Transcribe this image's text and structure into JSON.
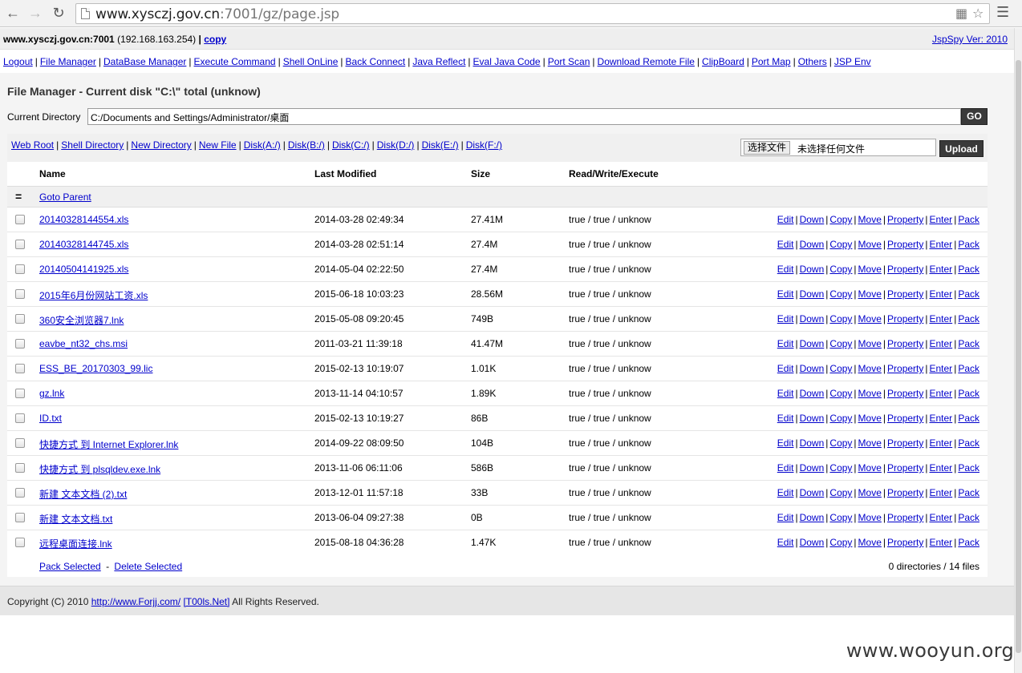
{
  "browser": {
    "url_host": "www.xysczj.gov.cn",
    "url_path": ":7001/gz/page.jsp"
  },
  "header": {
    "host": "www.xysczj.gov.cn:7001",
    "ip": "(192.168.163.254)",
    "separator": "|",
    "copy_label": "copy",
    "version_link": "JspSpy Ver: 2010"
  },
  "menu": [
    "Logout",
    "File Manager",
    "DataBase Manager",
    "Execute Command",
    "Shell OnLine",
    "Back Connect",
    "Java Reflect",
    "Eval Java Code",
    "Port Scan",
    "Download Remote File",
    "ClipBoard",
    "Port Map",
    "Others",
    "JSP Env"
  ],
  "file_manager": {
    "title": "File Manager - Current disk \"C:\\\" total (unknow)",
    "current_dir_label": "Current Directory",
    "current_dir_value": "C:/Documents and Settings/Administrator/桌面",
    "go_label": "GO",
    "shortcuts": [
      "Web Root",
      "Shell Directory",
      "New Directory",
      "New File",
      "Disk(A:/)",
      "Disk(B:/)",
      "Disk(C:/)",
      "Disk(D:/)",
      "Disk(E:/)",
      "Disk(F:/)"
    ],
    "choose_file_label": "选择文件",
    "no_file_label": "未选择任何文件",
    "upload_label": "Upload",
    "columns": {
      "name": "Name",
      "modified": "Last Modified",
      "size": "Size",
      "rwx": "Read/Write/Execute"
    },
    "parent_icon": "=",
    "goto_parent": "Goto Parent",
    "actions": [
      "Edit",
      "Down",
      "Copy",
      "Move",
      "Property",
      "Enter",
      "Pack"
    ],
    "files": [
      {
        "name": "20140328144554.xls",
        "modified": "2014-03-28 02:49:34",
        "size": "27.41M",
        "rwx": "true / true / unknow"
      },
      {
        "name": "20140328144745.xls",
        "modified": "2014-03-28 02:51:14",
        "size": "27.4M",
        "rwx": "true / true / unknow"
      },
      {
        "name": "20140504141925.xls",
        "modified": "2014-05-04 02:22:50",
        "size": "27.4M",
        "rwx": "true / true / unknow"
      },
      {
        "name": "2015年6月份网站工资.xls",
        "modified": "2015-06-18 10:03:23",
        "size": "28.56M",
        "rwx": "true / true / unknow"
      },
      {
        "name": "360安全浏览器7.lnk",
        "modified": "2015-05-08 09:20:45",
        "size": "749B",
        "rwx": "true / true / unknow"
      },
      {
        "name": "eavbe_nt32_chs.msi",
        "modified": "2011-03-21 11:39:18",
        "size": "41.47M",
        "rwx": "true / true / unknow"
      },
      {
        "name": "ESS_BE_20170303_99.lic",
        "modified": "2015-02-13 10:19:07",
        "size": "1.01K",
        "rwx": "true / true / unknow"
      },
      {
        "name": "gz.lnk",
        "modified": "2013-11-14 04:10:57",
        "size": "1.89K",
        "rwx": "true / true / unknow"
      },
      {
        "name": "ID.txt",
        "modified": "2015-02-13 10:19:27",
        "size": "86B",
        "rwx": "true / true / unknow"
      },
      {
        "name": "快捷方式 到 Internet Explorer.lnk",
        "modified": "2014-09-22 08:09:50",
        "size": "104B",
        "rwx": "true / true / unknow"
      },
      {
        "name": "快捷方式 到 plsqldev.exe.lnk",
        "modified": "2013-11-06 06:11:06",
        "size": "586B",
        "rwx": "true / true / unknow"
      },
      {
        "name": "新建 文本文档 (2).txt",
        "modified": "2013-12-01 11:57:18",
        "size": "33B",
        "rwx": "true / true / unknow"
      },
      {
        "name": "新建 文本文档.txt",
        "modified": "2013-06-04 09:27:38",
        "size": "0B",
        "rwx": "true / true / unknow"
      },
      {
        "name": "远程桌面连接.lnk",
        "modified": "2015-08-18 04:36:28",
        "size": "1.47K",
        "rwx": "true / true / unknow"
      }
    ],
    "pack_selected": "Pack Selected",
    "delete_selected": "Delete Selected",
    "summary": "0 directories / 14 files"
  },
  "footer": {
    "prefix": "Copyright (C) 2010",
    "link1": "http://www.Forjj.com/",
    "link2": "[T00ls.Net]",
    "suffix": "All Rights Reserved."
  },
  "watermark": "www.wooyun.org"
}
